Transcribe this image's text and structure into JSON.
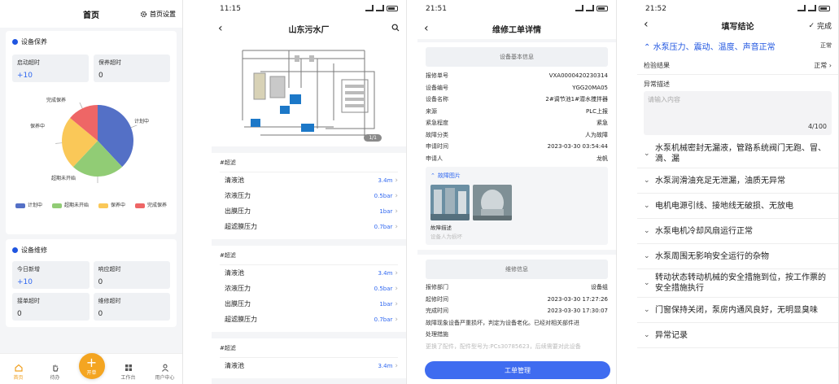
{
  "panel1": {
    "title": "首页",
    "settings_label": "首页设置",
    "maint": {
      "title": "设备保养",
      "stats": [
        {
          "label": "启动超时",
          "value": "+10",
          "blue": true
        },
        {
          "label": "保养超时",
          "value": "0",
          "blue": false
        }
      ]
    },
    "chart_data": {
      "type": "pie",
      "title": "",
      "categories": [
        "计划中",
        "超期未开始",
        "保养中",
        "完成保养"
      ],
      "values": [
        38,
        24,
        24,
        14
      ],
      "colors": [
        "#5470c6",
        "#91cc75",
        "#fac858",
        "#ee6666"
      ],
      "legend_position": "bottom"
    },
    "repair": {
      "title": "设备维修",
      "stats": [
        {
          "label": "今日新增",
          "value": "+10",
          "blue": true
        },
        {
          "label": "响应超时",
          "value": "0",
          "blue": false
        },
        {
          "label": "接单超时",
          "value": "0",
          "blue": false
        },
        {
          "label": "维修超时",
          "value": "0",
          "blue": false
        }
      ]
    },
    "tabs": {
      "home": "首页",
      "todo": "待办",
      "create": "开单",
      "workbench": "工作台",
      "user": "用户中心"
    }
  },
  "panel2": {
    "status_time": "11:15",
    "title": "山东污水厂",
    "image_counter": "1/1",
    "sections": [
      {
        "title": "#超滤",
        "rows": [
          {
            "label": "清液池",
            "value": "3.4m"
          },
          {
            "label": "浓液压力",
            "value": "0.5bar"
          },
          {
            "label": "出膜压力",
            "value": "1bar"
          },
          {
            "label": "超滤膜压力",
            "value": "0.7bar"
          }
        ]
      },
      {
        "title": "#超滤",
        "rows": [
          {
            "label": "清液池",
            "value": "3.4m"
          },
          {
            "label": "浓液压力",
            "value": "0.5bar"
          },
          {
            "label": "出膜压力",
            "value": "1bar"
          },
          {
            "label": "超滤膜压力",
            "value": "0.7bar"
          }
        ]
      },
      {
        "title": "#超滤",
        "rows": [
          {
            "label": "清液池",
            "value": "3.4m"
          }
        ]
      }
    ]
  },
  "panel3": {
    "status_time": "21:51",
    "title": "维修工单详情",
    "basic_info_label": "设备基本信息",
    "fields": [
      {
        "k": "报修单号",
        "v": "VXA0000420230314"
      },
      {
        "k": "设备编号",
        "v": "YGG20MA05"
      },
      {
        "k": "设备名称",
        "v": "2#调节池1#潜水搅拌器"
      },
      {
        "k": "来源",
        "v": "PLC上报"
      },
      {
        "k": "紧急程度",
        "v": "紧急"
      },
      {
        "k": "故障分类",
        "v": "人为故障"
      },
      {
        "k": "申请时间",
        "v": "2023-03-30 03:54:44"
      },
      {
        "k": "申请人",
        "v": "龙帆"
      }
    ],
    "fault_images_label": "故障图片",
    "fault_desc_label": "故障描述",
    "fault_desc_value": "设备人为损坏",
    "repair_info_label": "维修信息",
    "repair_fields": [
      {
        "k": "报修部门",
        "v": "设备组"
      },
      {
        "k": "起修时间",
        "v": "2023-03-30 17:27:26"
      },
      {
        "k": "完成时间",
        "v": "2023-03-30 17:30:07"
      }
    ],
    "repair_note": "故障现象设备严重损坏，判定为设备老化。已经对相关部件进",
    "measures_label": "处理措施",
    "measures_value": "更换了配件，配件型号为:PCs30785623，后续需要对此设备",
    "button_label": "工单管理"
  },
  "panel4": {
    "status_time": "21:52",
    "title": "填写结论",
    "done_label": "完成",
    "section_title": "水泵压力、震动、温度、声音正常",
    "section_status": "正常",
    "result_label": "检验结果",
    "result_value": "正常",
    "abnormal_label": "异常描述",
    "textarea_placeholder": "请输入内容",
    "textarea_counter": "4/100",
    "items": [
      "水泵机械密封无漏液，管路系统阀门无跑、冒、滴、漏",
      "水泵润滑油充足无泄漏，油质无异常",
      "电机电源引线、接地线无破损、无放电",
      "水泵电机冷却风扇运行正常",
      "水泵周围无影响安全运行的杂物",
      "转动状态转动机械的安全措施到位，按工作票的安全措施执行",
      "门窗保持关闭，泵房内通风良好，无明显臭味",
      "异常记录"
    ]
  }
}
